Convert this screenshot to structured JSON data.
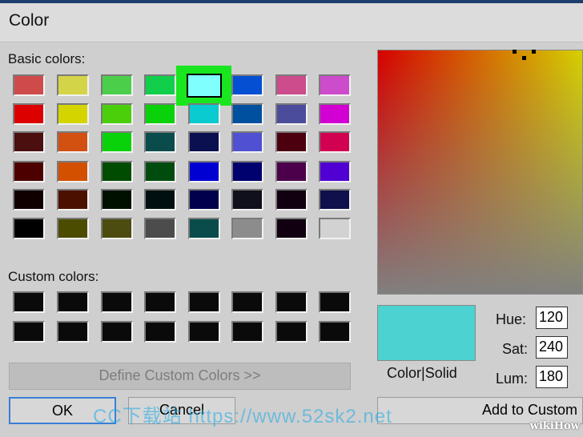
{
  "window": {
    "title": "Color"
  },
  "basic_colors": {
    "label": "Basic colors:",
    "rows": [
      [
        "#cf4b4b",
        "#d4d448",
        "#4bcf4b",
        "#12cf4b",
        "#80ffff",
        "#0550d2",
        "#cc4c8c",
        "#cc4ccc"
      ],
      [
        "#dc0000",
        "#d4d400",
        "#4bcf0a",
        "#0ad20a",
        "#0acbcf",
        "#0050a0",
        "#4c4c9c",
        "#d200d2"
      ],
      [
        "#4c0f0f",
        "#d25010",
        "#0ad20a",
        "#0a4c4c",
        "#0a1050",
        "#5050d2",
        "#4c000f",
        "#d20050"
      ],
      [
        "#4c0000",
        "#d25000",
        "#004c00",
        "#004c0f",
        "#0000d2",
        "#00006e",
        "#4c004c",
        "#5000d2"
      ],
      [
        "#100000",
        "#4c1000",
        "#001000",
        "#001010",
        "#00004c",
        "#10101c",
        "#100010",
        "#10104c"
      ],
      [
        "#000000",
        "#4c4c00",
        "#4c4c10",
        "#4c4c4c",
        "#0a4c4c",
        "#8c8c8c",
        "#100010",
        "#d2d2d2"
      ]
    ],
    "selected_row": 0,
    "selected_col": 4
  },
  "custom_colors": {
    "label": "Custom colors:",
    "rows": [
      [
        "#0a0a0a",
        "#0a0a0a",
        "#0a0a0a",
        "#0a0a0a",
        "#0a0a0a",
        "#0a0a0a",
        "#0a0a0a",
        "#0a0a0a"
      ],
      [
        "#0a0a0a",
        "#0a0a0a",
        "#0a0a0a",
        "#0a0a0a",
        "#0a0a0a",
        "#0a0a0a",
        "#0a0a0a",
        "#0a0a0a"
      ]
    ]
  },
  "preview": {
    "color": "#4cd2d0",
    "label": "Color|Solid"
  },
  "fields": {
    "hue": {
      "label": "Hue:",
      "value": "120"
    },
    "sat": {
      "label": "Sat:",
      "value": "240"
    },
    "lum": {
      "label": "Lum:",
      "value": "180"
    }
  },
  "buttons": {
    "define": "Define Custom Colors >>",
    "ok": "OK",
    "cancel": "Cancel",
    "add": "Add to Custom"
  },
  "watermark": {
    "text": "CC下载站 https://www.52sk2.net",
    "brand": "wikiHow"
  }
}
